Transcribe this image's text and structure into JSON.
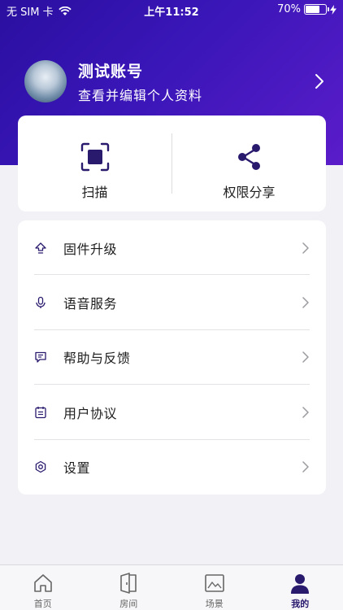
{
  "status_bar": {
    "carrier": "无 SIM 卡",
    "time": "上午11:52",
    "battery": "70%",
    "battery_level": 0.7
  },
  "profile": {
    "name": "测试账号",
    "subtitle": "查看并编辑个人资料"
  },
  "quick_actions": [
    {
      "label": "扫描",
      "icon": "scan-icon"
    },
    {
      "label": "权限分享",
      "icon": "share-icon"
    }
  ],
  "menu": [
    {
      "label": "固件升级",
      "icon": "upgrade-icon"
    },
    {
      "label": "语音服务",
      "icon": "microphone-icon"
    },
    {
      "label": "帮助与反馈",
      "icon": "chat-icon"
    },
    {
      "label": "用户协议",
      "icon": "document-icon"
    },
    {
      "label": "设置",
      "icon": "gear-icon"
    }
  ],
  "tabs": [
    {
      "label": "首页",
      "icon": "home-icon",
      "active": false
    },
    {
      "label": "房间",
      "icon": "door-icon",
      "active": false
    },
    {
      "label": "场景",
      "icon": "scene-icon",
      "active": false
    },
    {
      "label": "我的",
      "icon": "user-icon",
      "active": true
    }
  ],
  "colors": {
    "accent": "#2a1a6e",
    "header_start": "#2a0fa0",
    "header_end": "#5a1cc9"
  }
}
